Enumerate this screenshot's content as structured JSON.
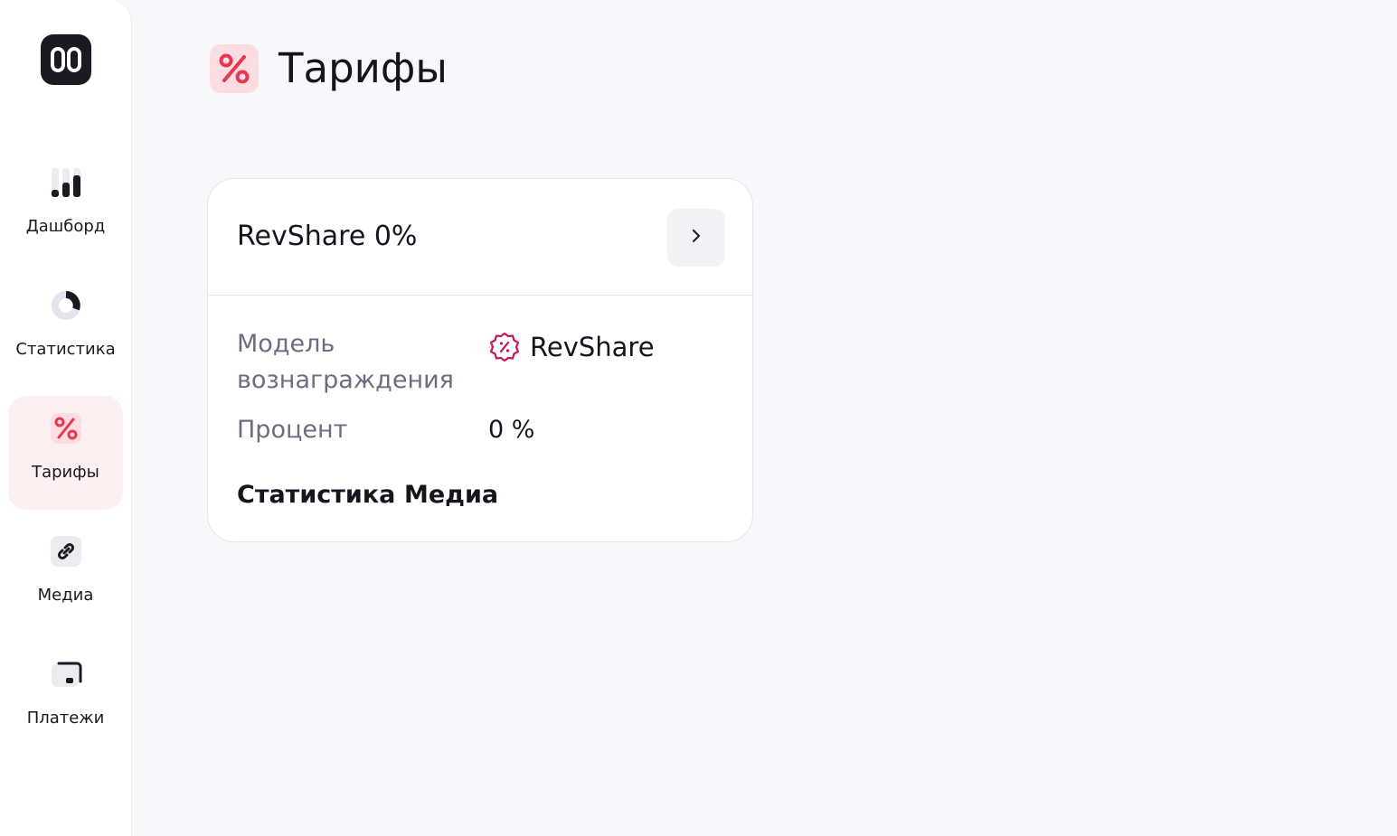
{
  "sidebar": {
    "logo_icon": "app-logo-icon",
    "items": [
      {
        "label": "Дашборд",
        "icon": "bar-chart-icon",
        "active": false
      },
      {
        "label": "Статистика",
        "icon": "donut-chart-icon",
        "active": false
      },
      {
        "label": "Тарифы",
        "icon": "percent-icon",
        "active": true
      },
      {
        "label": "Медиа",
        "icon": "link-icon",
        "active": false
      },
      {
        "label": "Платежи",
        "icon": "wallet-icon",
        "active": false
      }
    ]
  },
  "header": {
    "title": "Тарифы",
    "icon": "percent-icon"
  },
  "tariff_card": {
    "title": "RevShare 0%",
    "open_icon": "chevron-right-icon",
    "fields": [
      {
        "label": "Модель вознаграждения",
        "value": "RevShare",
        "icon": "discount-badge-icon"
      },
      {
        "label": "Процент",
        "value": "0 %"
      }
    ],
    "links": [
      "Статистика",
      "Медиа"
    ]
  },
  "colors": {
    "accent": "#e8384f",
    "accent_bg": "#fbdde2",
    "active_nav_bg": "#fdf0f2",
    "muted_text": "#6d6d82",
    "badge_color": "#c4184f"
  }
}
